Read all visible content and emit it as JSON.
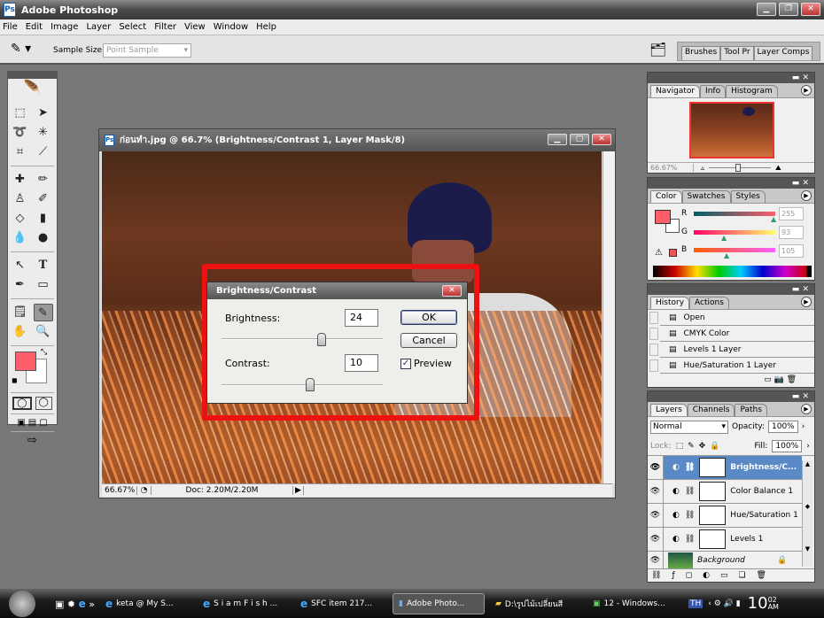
{
  "app": {
    "title": "Adobe Photoshop"
  },
  "menu": [
    "File",
    "Edit",
    "Image",
    "Layer",
    "Select",
    "Filter",
    "View",
    "Window",
    "Help"
  ],
  "options": {
    "sample_size_label": "Sample Size:",
    "sample_size_value": "Point Sample",
    "palette_tabs": [
      "Brushes",
      "Tool Pr",
      "Layer Comps"
    ]
  },
  "document": {
    "title": "ก่อนทำ.jpg @ 66.7% (Brightness/Contrast 1, Layer Mask/8)",
    "zoom": "66.67%",
    "doc_size": "Doc: 2.20M/2.20M"
  },
  "dialog": {
    "title": "Brightness/Contrast",
    "brightness_label": "Brightness:",
    "brightness_value": "24",
    "contrast_label": "Contrast:",
    "contrast_value": "10",
    "ok": "OK",
    "cancel": "Cancel",
    "preview_label": "Preview",
    "preview_checked": true,
    "brightness_slider_fraction": 0.62,
    "contrast_slider_fraction": 0.55
  },
  "navigator": {
    "tabs": [
      "Navigator",
      "Info",
      "Histogram"
    ],
    "zoom": "66.67%"
  },
  "color": {
    "tabs": [
      "Color",
      "Swatches",
      "Styles"
    ],
    "r_label": "R",
    "g_label": "G",
    "b_label": "B",
    "r": "255",
    "g": "93",
    "b": "105",
    "foreground": "#ff5d69"
  },
  "history": {
    "tabs": [
      "History",
      "Actions"
    ],
    "items": [
      "Open",
      "CMYK Color",
      "Levels 1 Layer",
      "Hue/Saturation 1 Layer"
    ]
  },
  "layers": {
    "tabs": [
      "Layers",
      "Channels",
      "Paths"
    ],
    "blend_mode": "Normal",
    "opacity_label": "Opacity:",
    "opacity": "100%",
    "lock_label": "Lock:",
    "fill_label": "Fill:",
    "fill": "100%",
    "items": [
      "Brightness/C...",
      "Color Balance 1",
      "Hue/Saturation 1",
      "Levels 1",
      "Background"
    ]
  },
  "taskbar": {
    "tasks": [
      "keta @ My S...",
      "S i a m F i s h ...",
      "SFC item 217...",
      "Adobe Photo...",
      "D:\\รูปไม้เปลี่ยนสี",
      "12 - Windows..."
    ],
    "lang": "TH",
    "clock": "10",
    "clock_sup": "02",
    "clock_ampm": "AM"
  }
}
